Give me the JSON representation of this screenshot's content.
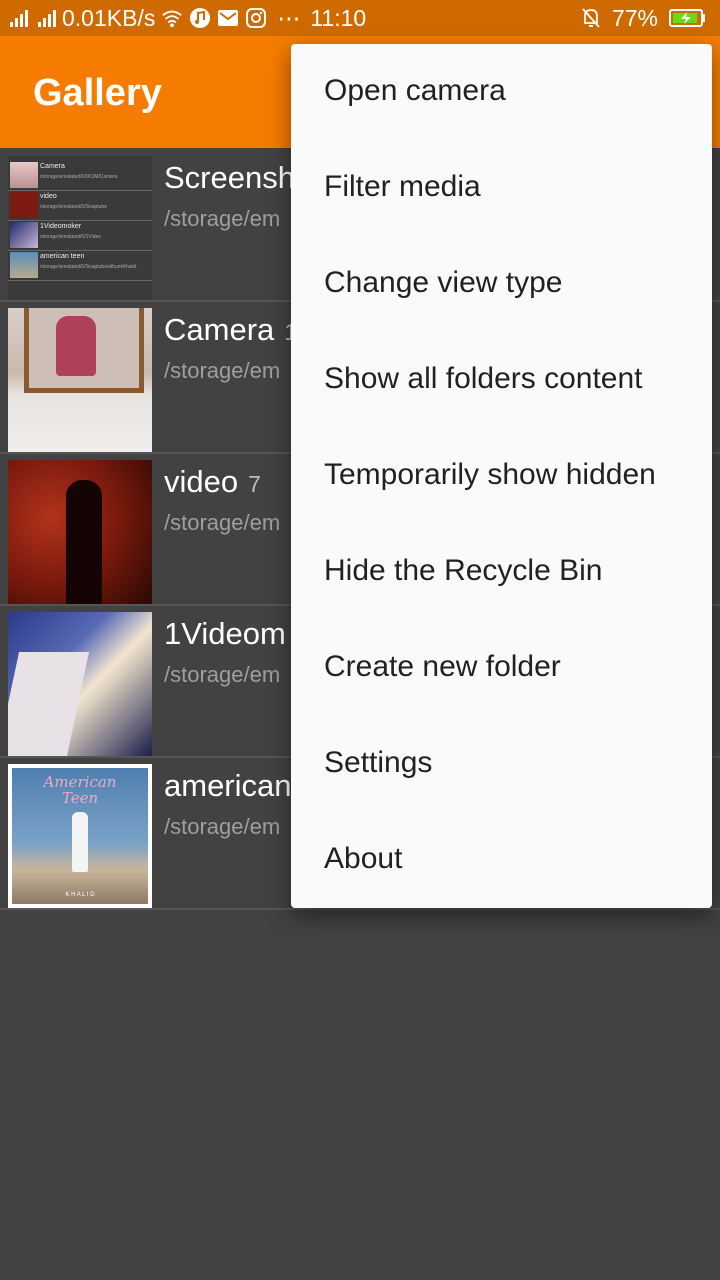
{
  "status_bar": {
    "network_speed": "0.01KB/s",
    "dots": "⋯",
    "time": "11:10",
    "battery": "77%",
    "icons": [
      "signal-icon",
      "signal-icon",
      "wifi-icon",
      "music-icon",
      "mail-icon",
      "instagram-icon",
      "mute-icon",
      "battery-charging-icon"
    ]
  },
  "app_bar": {
    "title": "Gallery"
  },
  "folders": [
    {
      "name": "Screensh",
      "count": "",
      "path": "/storage/em"
    },
    {
      "name": "Camera",
      "count": "1",
      "path": "/storage/em"
    },
    {
      "name": "video",
      "count": "7",
      "path": "/storage/em"
    },
    {
      "name": "1Videom",
      "count": "",
      "path": "/storage/em"
    },
    {
      "name": "american",
      "count": "",
      "path": "/storage/em"
    }
  ],
  "screenshot_preview_rows": [
    {
      "name": "Camera",
      "count": "112",
      "path": "/storage/emulated/0/DCIM/Camera"
    },
    {
      "name": "video",
      "count": "6",
      "path": "/storage/emulated/0/Snaptube"
    },
    {
      "name": "1Videomoker",
      "count": "4",
      "path": "/storage/emulated/0/1Video"
    },
    {
      "name": "american teen",
      "count": "4",
      "path": "/storage/emulated/0/Snaptube/album/khalid"
    }
  ],
  "album_art": {
    "title_line1": "American",
    "title_line2": "Teen",
    "artist": "K H A L I D"
  },
  "menu": {
    "items": [
      "Open camera",
      "Filter media",
      "Change view type",
      "Show all folders content",
      "Temporarily show hidden",
      "Hide the Recycle Bin",
      "Create new folder",
      "Settings",
      "About"
    ]
  },
  "colors": {
    "status_bar": "#cf6a00",
    "app_bar": "#f57c00",
    "background": "#424242",
    "menu_bg": "#fafafa"
  }
}
